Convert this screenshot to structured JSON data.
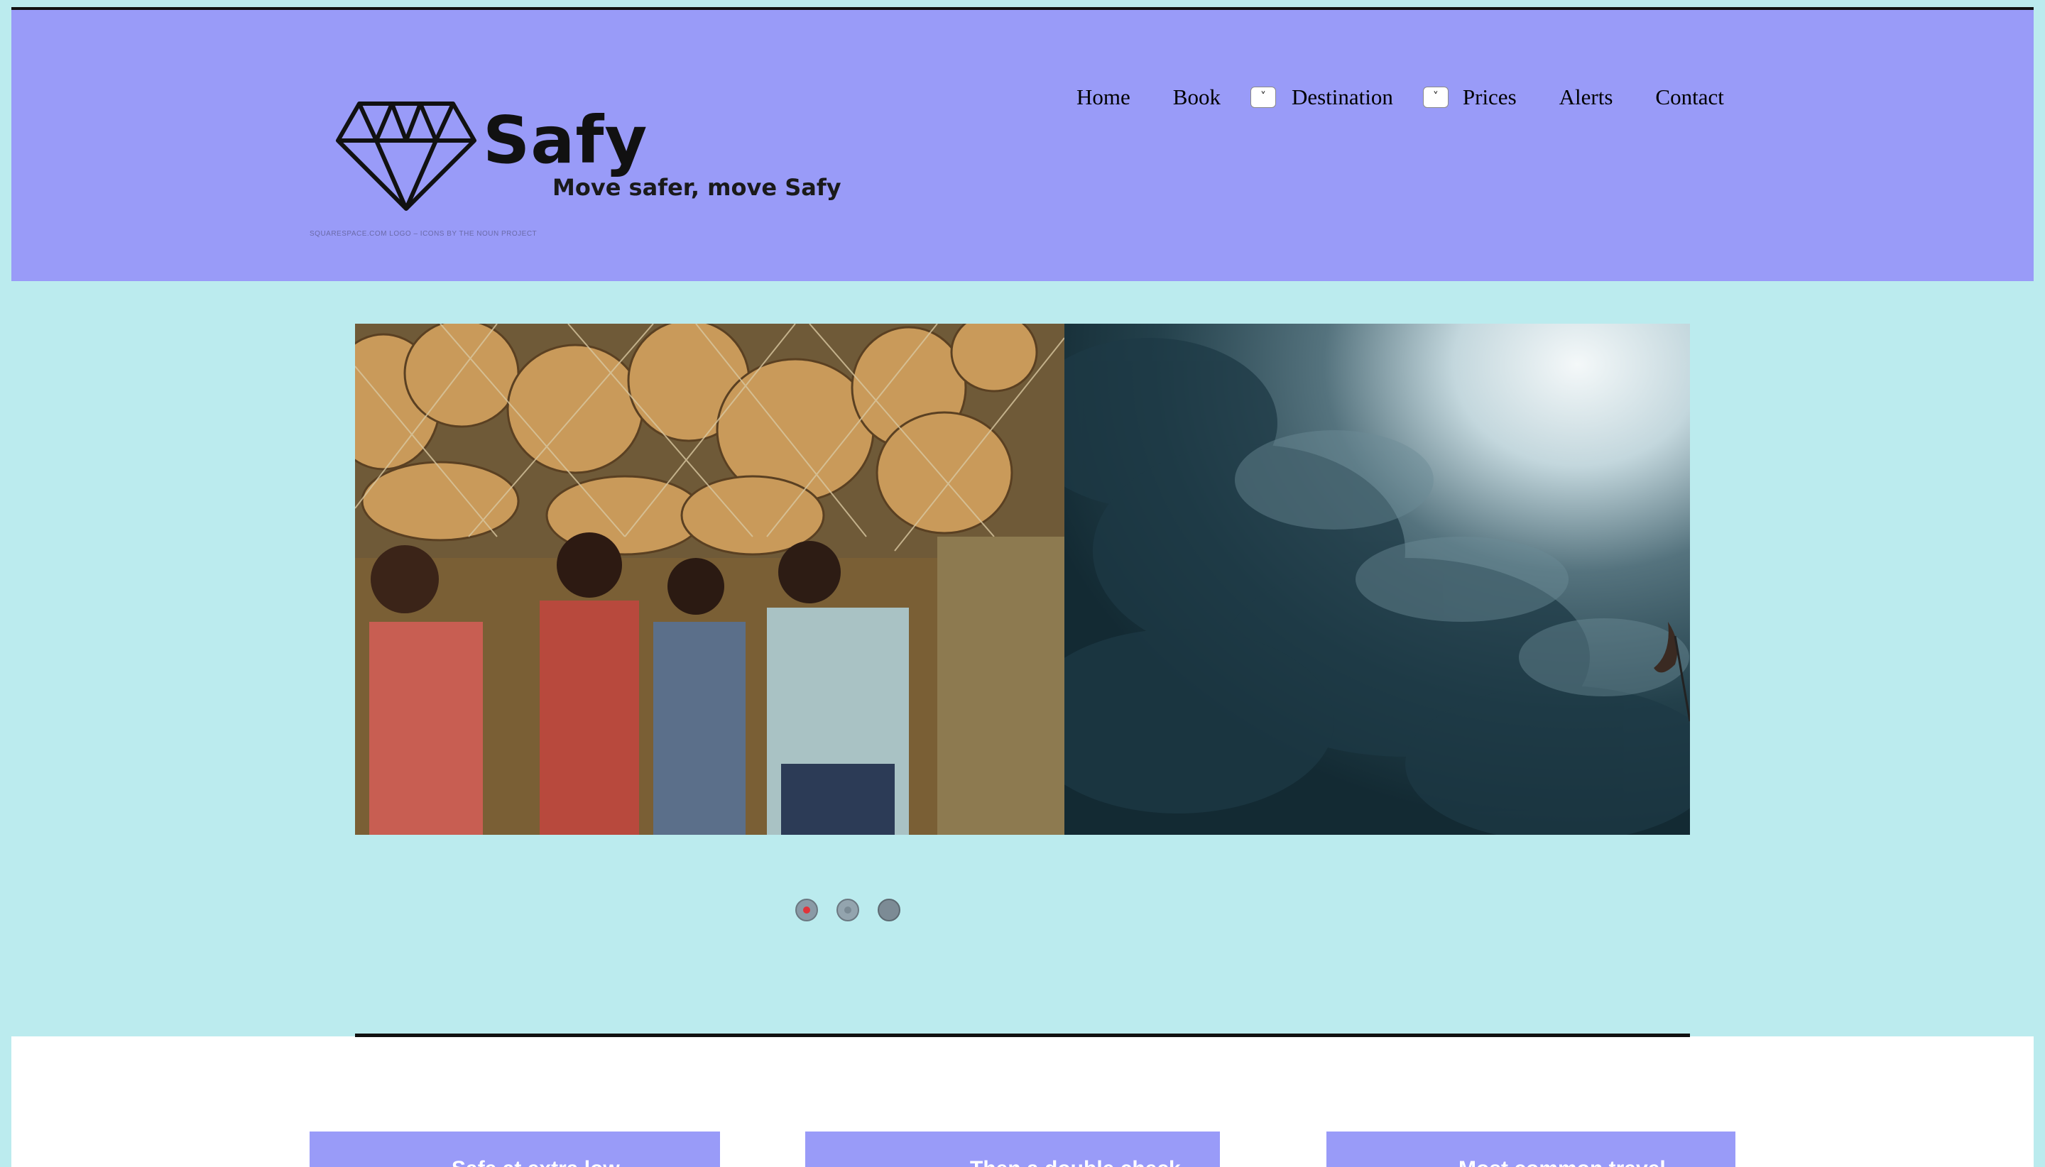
{
  "header": {
    "brand": "Safy",
    "tagline": "Move safer, move Safy",
    "logo_credit": "SQUARESPACE.COM LOGO – ICONS BY THE NOUN PROJECT",
    "logo_icon": "diamond-icon"
  },
  "nav": {
    "items": [
      {
        "label": "Home"
      },
      {
        "label": "Book"
      },
      {
        "label": "Destination",
        "has_dropdown": true,
        "toggle": "˅"
      },
      {
        "label": "Prices",
        "has_dropdown": true,
        "toggle": "˅"
      },
      {
        "label": "Alerts"
      },
      {
        "label": "Contact"
      }
    ]
  },
  "slider": {
    "slide_count": 3,
    "active_slide": 1,
    "slides": [
      {
        "image": "villagers-carrying-gourds-photo"
      },
      {
        "image": "stormy-sea-wave-photo"
      }
    ]
  },
  "features": [
    {
      "title": "Safe at extra low"
    },
    {
      "title": "Then a double check"
    },
    {
      "title": "Most common travel"
    }
  ],
  "colors": {
    "page_bg": "#bbebee",
    "header_bg": "#999bf8",
    "card_bg": "#999bf8",
    "active_dot": "#e0333a"
  }
}
